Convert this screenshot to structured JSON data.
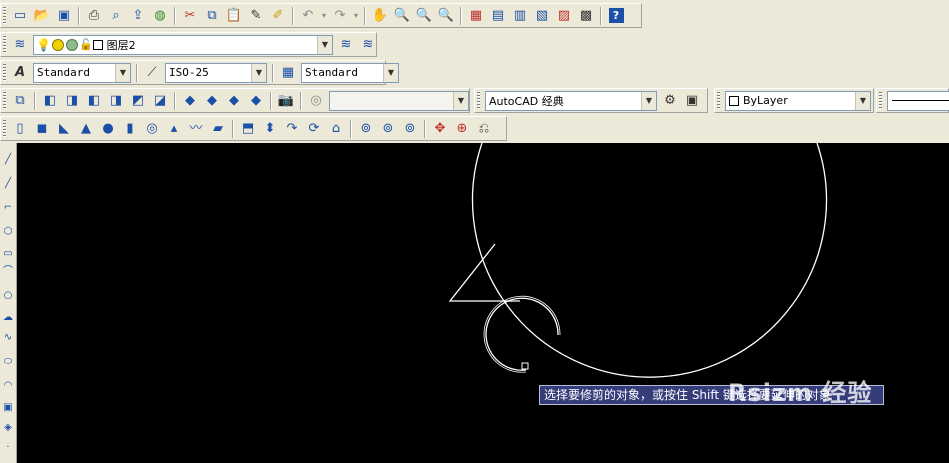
{
  "toolbar1": {
    "icons": [
      "new-icon",
      "open-icon",
      "save-icon",
      "print-icon",
      "preview-icon",
      "publish-icon",
      "3d-publish-icon",
      "cut-icon",
      "copy-icon",
      "paste-icon",
      "match-properties-icon",
      "block-editor-icon",
      "undo-icon",
      "redo-icon",
      "pan-icon",
      "zoom-realtime-icon",
      "zoom-window-icon",
      "zoom-previous-icon",
      "properties-icon",
      "design-center-icon",
      "tool-palettes-icon",
      "sheet-set-icon",
      "markup-icon",
      "calculator-icon",
      "help-icon"
    ]
  },
  "layers": {
    "current_layer": "图层2"
  },
  "styles": {
    "text_style": "Standard",
    "dim_style": "ISO-25",
    "table_style": "Standard"
  },
  "workspace": {
    "view_combo": "",
    "workspace_name": "AutoCAD 经典"
  },
  "properties": {
    "color": "ByLayer"
  },
  "command": {
    "tooltip": "选择要修剪的对象，或按住 Shift 键选择要延伸的对象"
  },
  "watermark": {
    "text": "Rsizm 经验"
  },
  "colors": {
    "canvas": "#000000",
    "geometry": "#ffffff",
    "tooltip_bg": "#353c7a",
    "toolbar_bg": "#ece9d8"
  }
}
